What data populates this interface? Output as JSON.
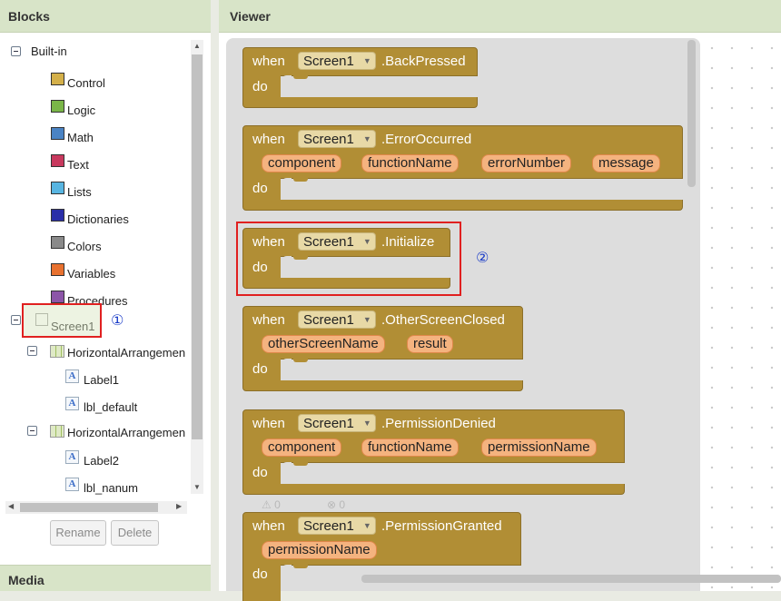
{
  "panels": {
    "blocks_title": "Blocks",
    "viewer_title": "Viewer",
    "media_title": "Media"
  },
  "tree": {
    "root_label": "Built-in",
    "builtins": [
      {
        "label": "Control",
        "color": "#d4b04a"
      },
      {
        "label": "Logic",
        "color": "#7ab648"
      },
      {
        "label": "Math",
        "color": "#4a83c4"
      },
      {
        "label": "Text",
        "color": "#c8395e"
      },
      {
        "label": "Lists",
        "color": "#58b5e1"
      },
      {
        "label": "Dictionaries",
        "color": "#2a2ea8"
      },
      {
        "label": "Colors",
        "color": "#8a8a8a"
      },
      {
        "label": "Variables",
        "color": "#e8712f"
      },
      {
        "label": "Procedures",
        "color": "#8c55a8"
      }
    ],
    "screen_label": "Screen1",
    "components": [
      {
        "label": "HorizontalArrangemen",
        "children": [
          "Label1",
          "lbl_default"
        ]
      },
      {
        "label": "HorizontalArrangemen",
        "children": [
          "Label2",
          "lbl_nanum"
        ]
      }
    ]
  },
  "buttons": {
    "rename": "Rename",
    "delete": "Delete"
  },
  "annotations": {
    "marker_1": "①",
    "marker_2": "②"
  },
  "blocks": {
    "when": "when",
    "do": "do",
    "screen": "Screen1",
    "events": [
      {
        "name": ".BackPressed",
        "params": []
      },
      {
        "name": ".ErrorOccurred",
        "params": [
          "component",
          "functionName",
          "errorNumber",
          "message"
        ]
      },
      {
        "name": ".Initialize",
        "params": []
      },
      {
        "name": ".OtherScreenClosed",
        "params": [
          "otherScreenName",
          "result"
        ]
      },
      {
        "name": ".PermissionDenied",
        "params": [
          "component",
          "functionName",
          "permissionName"
        ]
      },
      {
        "name": ".PermissionGranted",
        "params": [
          "permissionName"
        ]
      }
    ]
  },
  "status": {
    "warnings": "0",
    "errors": "0"
  }
}
